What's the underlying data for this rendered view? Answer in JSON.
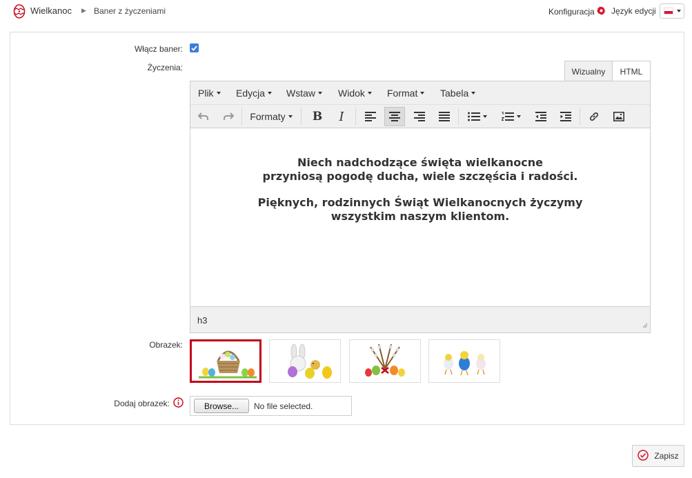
{
  "header": {
    "app_title": "Wielkanoc",
    "breadcrumb_item": "Baner z życzeniami",
    "config_label": "Konfiguracja",
    "lang_label": "Język edycji",
    "flag_icon": "flag-pl-icon",
    "accent_color": "#c3001a"
  },
  "form": {
    "enable_label": "Włącz baner:",
    "enable_checked": true,
    "wishes_label": "Życzenia:",
    "image_label": "Obrazek:",
    "add_image_label": "Dodaj obrazek:"
  },
  "editor": {
    "tabs": [
      {
        "label": "Wizualny",
        "active": true
      },
      {
        "label": "HTML",
        "active": false
      }
    ],
    "menus": [
      "Plik",
      "Edycja",
      "Wstaw",
      "Widok",
      "Format",
      "Tabela"
    ],
    "formats_label": "Formaty",
    "toolbar_icons": [
      "undo-icon",
      "redo-icon",
      "bold-icon",
      "italic-icon",
      "align-left-icon",
      "align-center-icon",
      "align-right-icon",
      "align-justify-icon",
      "bullet-list-icon",
      "numbered-list-icon",
      "outdent-icon",
      "indent-icon",
      "link-icon",
      "image-icon"
    ],
    "active_tool": "align-center-icon",
    "content": {
      "p1_line1": "Niech nadchodzące święta wielkanocne",
      "p1_line2": "przyniosą pogodę ducha, wiele szczęścia i radości.",
      "p2_line1": "Pięknych, rodzinnych Świąt Wielkanocnych życzymy",
      "p2_line2": "wszystkim naszym klientom."
    },
    "status_path": "h3"
  },
  "images": [
    {
      "name": "easter-basket-image",
      "selected": true
    },
    {
      "name": "bunny-chick-eggs-image",
      "selected": false
    },
    {
      "name": "pussy-willow-eggs-image",
      "selected": false
    },
    {
      "name": "chicks-eggs-image",
      "selected": false
    }
  ],
  "file_input": {
    "button_label": "Browse...",
    "status": "No file selected."
  },
  "save_label": "Zapisz"
}
